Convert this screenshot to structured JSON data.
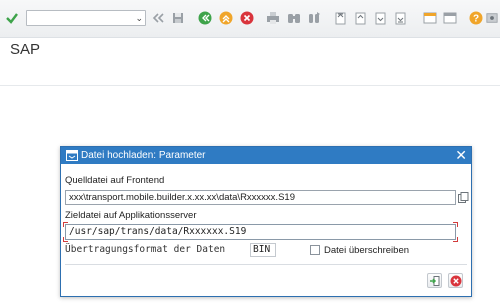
{
  "toolbar": {
    "command_field_value": "",
    "icons": [
      "enter-icon",
      "back-icon",
      "save-icon",
      "back-nav-icon",
      "exit-icon",
      "cancel-icon",
      "print-icon",
      "find-icon",
      "find-next-icon",
      "first-page-icon",
      "previous-page-icon",
      "next-page-icon",
      "last-page-icon",
      "new-session-icon",
      "shortcut-icon",
      "help-icon",
      "customize-icon"
    ]
  },
  "app": {
    "title": "SAP"
  },
  "dialog": {
    "title": "Datei hochladen: Parameter",
    "source_label": "Quelldatei auf Frontend",
    "source_value": "xxx\\transport.mobile.builder.x.xx.xx\\data\\Rxxxxxx.S19",
    "target_label": "Zieldatei auf Applikationsserver",
    "target_value": "/usr/sap/trans/data/Rxxxxxx.S19",
    "format_label": "Übertragungsformat der Daten",
    "format_value": "BIN",
    "overwrite_label": "Datei überschreiben",
    "overwrite_checked": false
  },
  "colors": {
    "dialog_header": "#2f7bc3",
    "accent_green": "#3ea34a",
    "accent_orange": "#f0a52a",
    "accent_red": "#d9343c"
  }
}
